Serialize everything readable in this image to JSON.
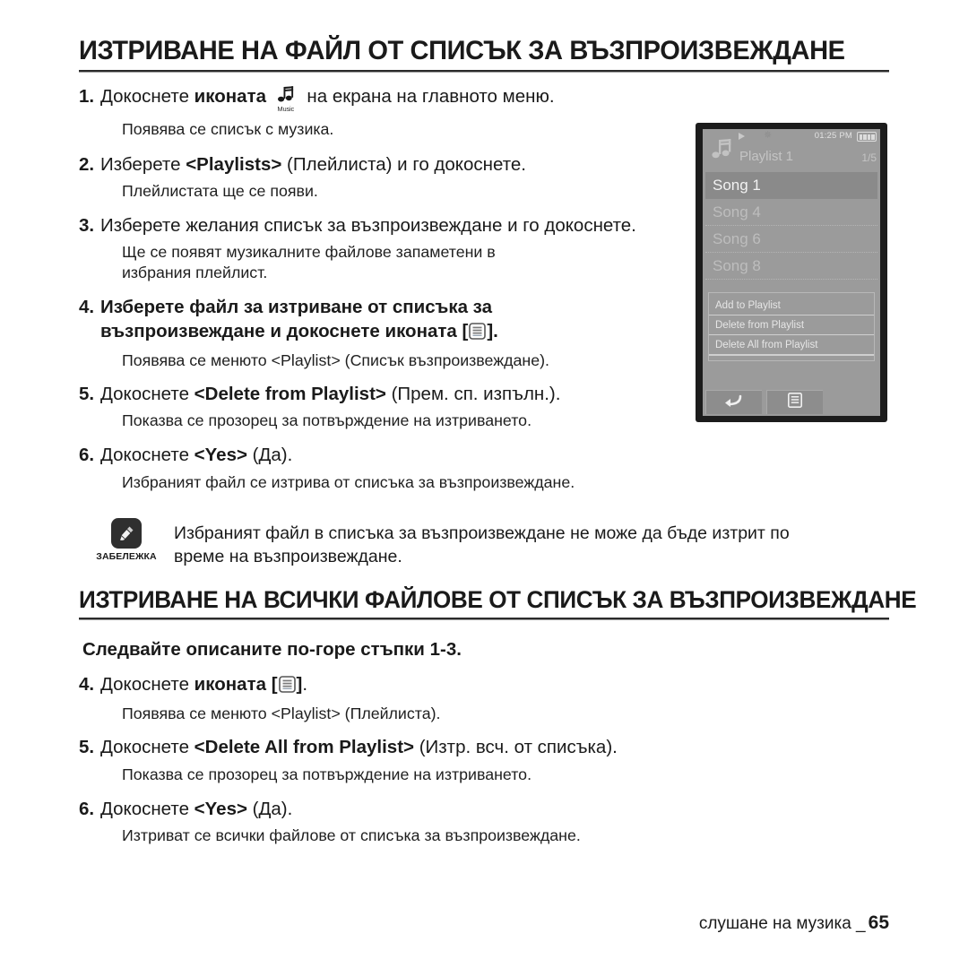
{
  "section1": {
    "heading": "ИЗТРИВАНЕ НА ФАЙЛ ОТ СПИСЪК ЗА ВЪЗПРОИЗВЕЖДАНЕ",
    "steps": [
      {
        "num": "1.",
        "lead": "Докоснете",
        "bold_before": "иконата",
        "icon": "music-note-icon",
        "icon_caption": "Music",
        "text_after": "на екрана на главното меню.",
        "sub": "Появява се списък с музика."
      },
      {
        "num": "2.",
        "lead": "Изберете",
        "bold_term": "<Playlists>",
        "text_after": "(Плейлиста) и го докоснете.",
        "sub": "Плейлистата  ще се появи."
      },
      {
        "num": "3.",
        "text": "Изберете желания списък за възпроизвеждане и го докоснете.",
        "sub": "Ще се появят музикалните файлове запаметени в",
        "sub2": "избрания плейлист."
      },
      {
        "num": "4.",
        "line1": "Изберете файл за изтриване от списъка за",
        "line2_a": "възпроизвеждане и докоснете",
        "line2_bold": "иконата",
        "line2_icon": "list-menu-icon",
        "sub": "Появява се менюто <Playlist> (Списък възпроизвеждане)."
      },
      {
        "num": "5.",
        "lead": "Докоснете",
        "bold_term": "<Delete from Playlist>",
        "text_after": "(Прем. сп. изпълн.).",
        "sub": "Показва се прозорец за потвърждение на изтриването."
      },
      {
        "num": "6.",
        "lead": "Докоснете",
        "bold_term": "<Yes>",
        "text_after": "(Да).",
        "sub": "Избраният файл се изтрива от списъка за възпроизвеждане."
      }
    ]
  },
  "note": {
    "icon": "note-pencil-icon",
    "label": "ЗАБЕЛЕЖКА",
    "line1": "Избраният файл в списъка за възпроизвеждане не може да бъде изтрит по",
    "line2": "време на възпроизвеждане."
  },
  "section2": {
    "heading": "ИЗТРИВАНЕ НА ВСИЧКИ ФАЙЛОВЕ ОТ СПИСЪК ЗА ВЪЗПРОИЗВЕЖДАНЕ",
    "intro": "Следвайте описаните по-горе стъпки 1-3.",
    "steps": [
      {
        "num": "4.",
        "lead": "Докоснете",
        "bold_before": "иконата",
        "icon": "list-menu-icon",
        "sub": "Появява се менюто <Playlist> (Плейлиста)."
      },
      {
        "num": "5.",
        "lead": "Докоснете",
        "bold_term": "<Delete All from Playlist>",
        "text_after": "(Изтр. всч. от списъка).",
        "sub": "Показва се прозорец за потвърждение на изтриването."
      },
      {
        "num": "6.",
        "lead": "Докоснете",
        "bold_term": "<Yes>",
        "text_after": "(Да).",
        "sub": "Изтриват се всички файлове от списъка за възпроизвеждане."
      }
    ]
  },
  "device": {
    "status": {
      "play_icon": "play-icon",
      "bluetooth_icon": "bluetooth-icon",
      "time": "01:25 PM",
      "battery_icon": "battery-full-icon"
    },
    "title": "Playlist 1",
    "count": "1/5",
    "songs": [
      {
        "label": "Song 1",
        "selected": true
      },
      {
        "label": "Song 4",
        "selected": false
      },
      {
        "label": "Song 6",
        "selected": false
      },
      {
        "label": "Song 8",
        "selected": false
      }
    ],
    "menu": [
      "Add to Playlist",
      "Delete from Playlist",
      "Delete All from Playlist"
    ],
    "softkeys": [
      {
        "icon": "back-arrow-icon"
      },
      {
        "icon": "list-menu-icon"
      }
    ]
  },
  "footer": {
    "text": "слушане на музика _",
    "page": "65"
  }
}
